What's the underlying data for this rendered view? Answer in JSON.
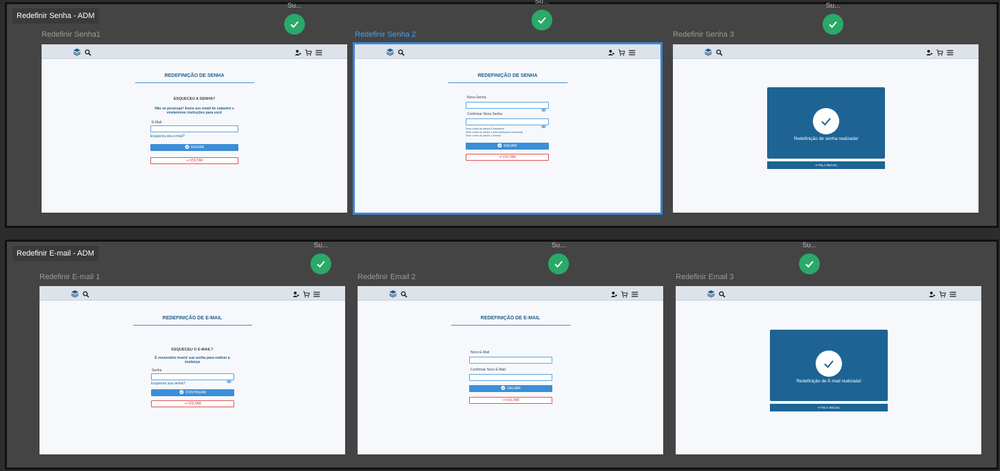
{
  "sections": {
    "senha": {
      "title": "Redefinir Senha - ADM"
    },
    "email": {
      "title": "Redefinir E-mail - ADM"
    }
  },
  "status": {
    "s1": "Su...",
    "s2": "Su...",
    "s3": "Su...",
    "e1": "Su...",
    "e2": "Su...",
    "e3": "Su..."
  },
  "frames": {
    "senha1": {
      "label": "Redefinir Senha1",
      "title": "REDEFINIÇÃO DE SENHA",
      "question": "ESQUECEU A SENHA?",
      "message": "Não se preocupe! Insira seu email de cadastro e enviaremos instruções para você",
      "field_label": "E-Mail",
      "forgot_link": "Esqueceu seu e-mail?",
      "primary_button": "ENVIAR",
      "back_button": "VOLTAR"
    },
    "senha2": {
      "label": "Redefinir Senha 2",
      "title": "REDEFINIÇÃO DE SENHA",
      "field1_label": "Nova Senha",
      "field2_label": "Confirmar Nova Senha",
      "rule1": "Deve conter ao menos 8 caracteres",
      "rule2": "Deve conter ao menos 1 letra maiúscula e minúscula",
      "rule3": "Deve conter ao menos 1 número",
      "primary_button": "SALVAR",
      "back_button": "VOLTAR"
    },
    "senha3": {
      "label": "Redefinir Senha 3",
      "success_text": "Redefinição de senha realizada!",
      "home_button": "TELA INICIAL"
    },
    "email1": {
      "label": "Redefinir E-mail 1",
      "title": "REDEFINIÇÃO DE E-MAIL",
      "question": "ESQUECEU O E-MAIL?",
      "message": "É necessário inserir sua senha para realizar a mudança",
      "field_label": "Senha",
      "forgot_link": "Esqueceu sua senha?",
      "primary_button": "CONTINUAR",
      "back_button": "VOLTAR"
    },
    "email2": {
      "label": "Redefinir Email 2",
      "title": "REDEFINIÇÃO DE E-MAIL",
      "field1_label": "Novo E-Mail",
      "field2_label": "Confirmar Novo E-Mail",
      "primary_button": "SALVAR",
      "back_button": "VOLTAR"
    },
    "email3": {
      "label": "Redefinir Email 3",
      "success_text": "Redefinição de E-mail realizada!",
      "home_button": "TELA INICIAL"
    }
  },
  "icons": {
    "logo": "layers-logo-icon",
    "search": "search-icon",
    "user": "user-add-icon",
    "cart": "cart-icon",
    "menu": "menu-icon",
    "status": "check-circle-icon"
  },
  "colors": {
    "canvas": "#2c2c2c",
    "section": "#444444",
    "success": "#2aa968",
    "primary": "#3a8fd8",
    "dark_blue": "#1d6494",
    "danger": "#e05555",
    "selection": "#3a86d9"
  }
}
